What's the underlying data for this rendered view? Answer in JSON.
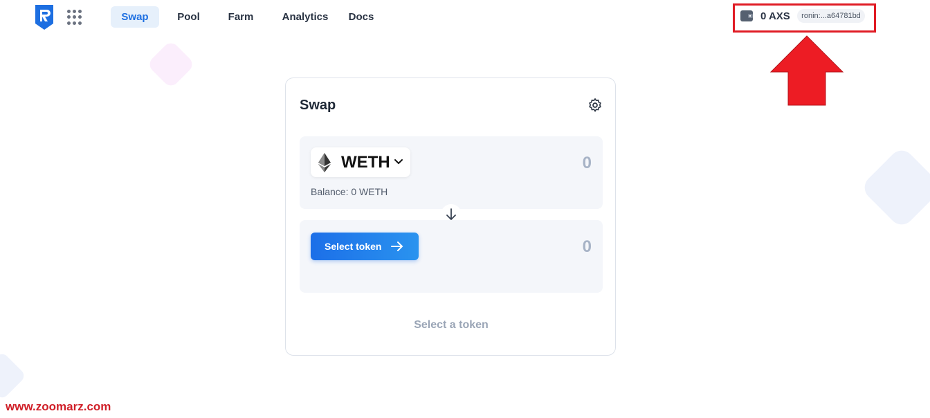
{
  "header": {
    "nav": [
      "Swap",
      "Pool",
      "Farm",
      "Analytics",
      "Docs"
    ],
    "active_tab": "Swap",
    "wallet_balance": "0 AXS",
    "wallet_address": "ronin:...a64781bd"
  },
  "swap": {
    "title": "Swap",
    "from": {
      "token": "WETH",
      "amount": "0",
      "balance": "Balance: 0 WETH"
    },
    "to": {
      "button_label": "Select token",
      "amount": "0"
    },
    "footer": "Select a token"
  },
  "watermark": "www.zoomarz.com",
  "colors": {
    "accent": "#1d6fe1",
    "annotation_red": "#e01b24",
    "panel_bg": "#f4f6fa"
  },
  "icons": [
    "ronin-logo-icon",
    "apps-grid-icon",
    "wallet-icon",
    "settings-gear-icon",
    "ethereum-icon",
    "chevron-down-icon",
    "arrow-down-icon",
    "arrow-right-icon",
    "red-arrow-up-annotation"
  ]
}
